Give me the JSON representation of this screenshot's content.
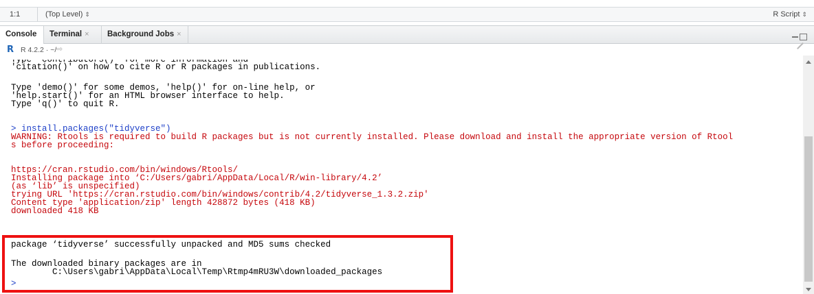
{
  "statusbar": {
    "position": "1:1",
    "scope": "(Top Level)",
    "file_type": "R Script"
  },
  "tabs": [
    {
      "label": "Console",
      "closable": false,
      "active": true
    },
    {
      "label": "Terminal",
      "closable": true,
      "active": false
    },
    {
      "label": "Background Jobs",
      "closable": true,
      "active": false
    }
  ],
  "console_header": {
    "r_version": "R 4.2.2",
    "working_dir": "~/"
  },
  "console_lines": [
    {
      "text": "'citation()' on how to cite R or R packages in publications.",
      "type": "output"
    },
    {
      "text": "Type 'demo()' for some demos, 'help()' for on-line help, or",
      "type": "output"
    },
    {
      "text": "'help.start()' for an HTML browser interface to help.",
      "type": "output"
    },
    {
      "text": "Type 'q()' to quit R.",
      "type": "output"
    },
    {
      "text": "> install.packages(\"tidyverse\")",
      "type": "command"
    },
    {
      "text": "WARNING: Rtools is required to build R packages but is not currently installed. Please download and install the appropriate version of Rtool",
      "type": "error"
    },
    {
      "text": "s before proceeding:",
      "type": "error"
    },
    {
      "text": "https://cran.rstudio.com/bin/windows/Rtools/",
      "type": "error"
    },
    {
      "text": "Installing package into ‘C:/Users/gabri/AppData/Local/R/win-library/4.2’",
      "type": "error"
    },
    {
      "text": "(as ‘lib’ is unspecified)",
      "type": "error"
    },
    {
      "text": "trying URL 'https://cran.rstudio.com/bin/windows/contrib/4.2/tidyverse_1.3.2.zip'",
      "type": "error"
    },
    {
      "text": "Content type 'application/zip' length 428872 bytes (418 KB)",
      "type": "error"
    },
    {
      "text": "downloaded 418 KB",
      "type": "error"
    },
    {
      "text": "package ‘tidyverse’ successfully unpacked and MD5 sums checked",
      "type": "output"
    },
    {
      "text": "The downloaded binary packages are in",
      "type": "output"
    },
    {
      "text": "        C:\\Users\\gabri\\AppData\\Local\\Temp\\Rtmp4mRU3W\\downloaded_packages",
      "type": "output"
    },
    {
      "text": "> ",
      "type": "command"
    }
  ],
  "icons": {
    "r_logo": "r-logo-icon",
    "goto_dir": "goto-directory-icon",
    "clear_console": "broom-icon",
    "minimize": "minimize-icon",
    "maximize": "maximize-icon",
    "close_tab": "close-icon"
  },
  "colors": {
    "error": "#c5060b",
    "command": "#1e40c8",
    "highlight": "#ee1111"
  }
}
